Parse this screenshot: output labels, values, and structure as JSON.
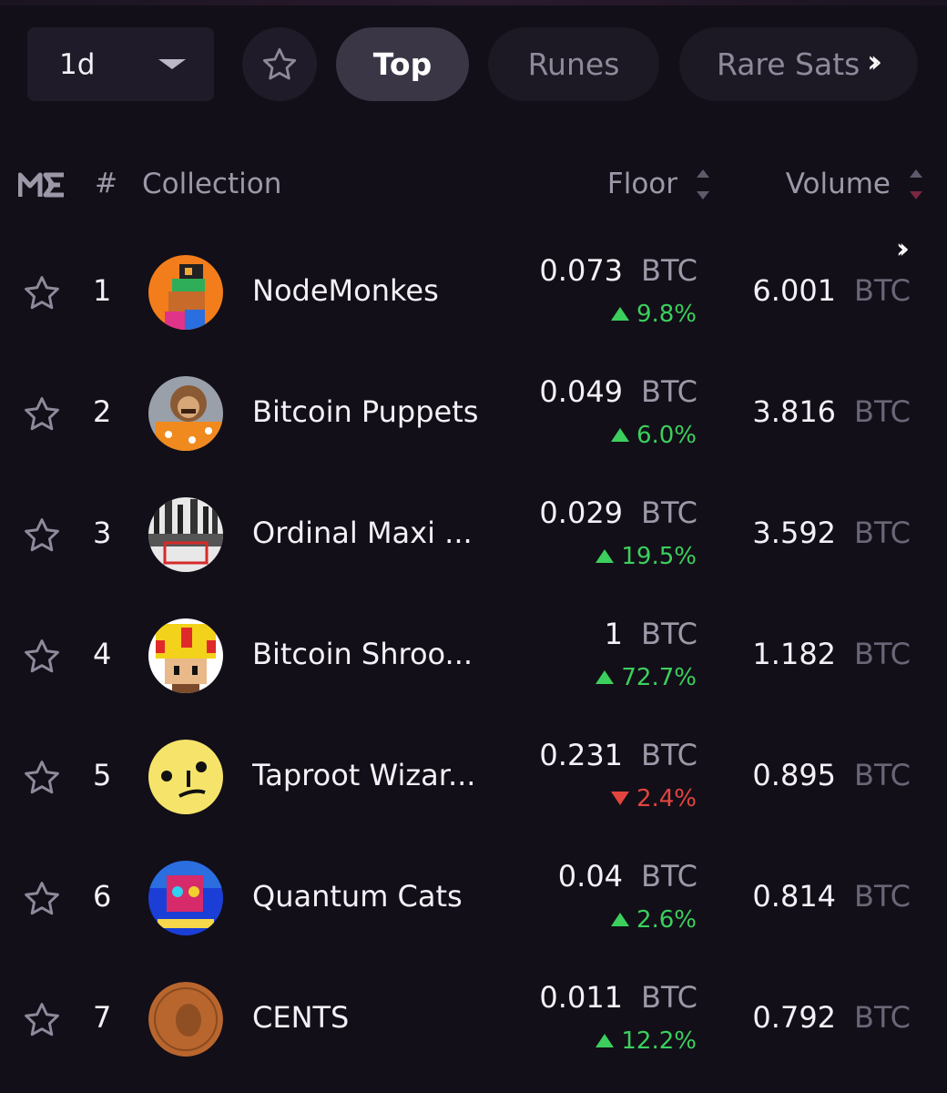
{
  "filters": {
    "period": "1d",
    "tabs": [
      {
        "label": "Top",
        "active": true
      },
      {
        "label": "Runes",
        "active": false
      },
      {
        "label": "Rare Sats",
        "active": false
      }
    ],
    "more_icon": "double-chevron-right-icon",
    "favorites_icon": "star-icon"
  },
  "header": {
    "logo": "ME",
    "rank": "#",
    "collection": "Collection",
    "floor": "Floor",
    "volume": "Volume"
  },
  "colors": {
    "background": "#120f18",
    "positive": "#3ccf5d",
    "negative": "#e2453f",
    "active_tab": "#3a3645"
  },
  "rows": [
    {
      "rank": "1",
      "name": "NodeMonkes",
      "floor": "0.073",
      "floor_unit": "BTC",
      "change": "9.8%",
      "direction": "up",
      "volume": "6.001",
      "volume_unit": "BTC"
    },
    {
      "rank": "2",
      "name": "Bitcoin Puppets",
      "floor": "0.049",
      "floor_unit": "BTC",
      "change": "6.0%",
      "direction": "up",
      "volume": "3.816",
      "volume_unit": "BTC"
    },
    {
      "rank": "3",
      "name": "Ordinal Maxi ...",
      "floor": "0.029",
      "floor_unit": "BTC",
      "change": "19.5%",
      "direction": "up",
      "volume": "3.592",
      "volume_unit": "BTC"
    },
    {
      "rank": "4",
      "name": "Bitcoin Shroo...",
      "floor": "1",
      "floor_unit": "BTC",
      "change": "72.7%",
      "direction": "up",
      "volume": "1.182",
      "volume_unit": "BTC"
    },
    {
      "rank": "5",
      "name": "Taproot Wizar...",
      "floor": "0.231",
      "floor_unit": "BTC",
      "change": "2.4%",
      "direction": "down",
      "volume": "0.895",
      "volume_unit": "BTC"
    },
    {
      "rank": "6",
      "name": "Quantum Cats",
      "floor": "0.04",
      "floor_unit": "BTC",
      "change": "2.6%",
      "direction": "up",
      "volume": "0.814",
      "volume_unit": "BTC"
    },
    {
      "rank": "7",
      "name": "CENTS",
      "floor": "0.011",
      "floor_unit": "BTC",
      "change": "12.2%",
      "direction": "up",
      "volume": "0.792",
      "volume_unit": "BTC"
    }
  ]
}
